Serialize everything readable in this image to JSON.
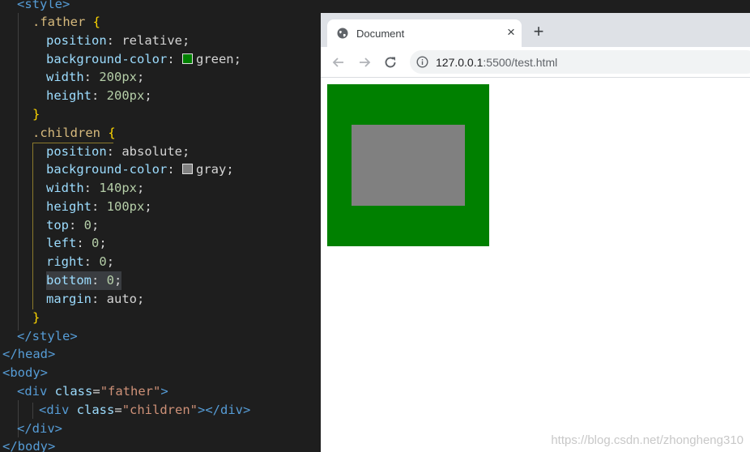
{
  "editor": {
    "lines": {
      "l0": {
        "tag": "<style>"
      },
      "l1": {
        "selector": ".father",
        "brace": "{"
      },
      "l2": {
        "prop": "position",
        "value": "relative"
      },
      "l3": {
        "prop": "background-color",
        "value": "green",
        "swatch": "#008000"
      },
      "l4": {
        "prop": "width",
        "value": "200px"
      },
      "l5": {
        "prop": "height",
        "value": "200px"
      },
      "l6": {
        "brace": "}"
      },
      "l7": {
        "selector": ".children",
        "brace": "{"
      },
      "l8": {
        "prop": "position",
        "value": "absolute"
      },
      "l9": {
        "prop": "background-color",
        "value": "gray",
        "swatch": "#808080"
      },
      "l10": {
        "prop": "width",
        "value": "140px"
      },
      "l11": {
        "prop": "height",
        "value": "100px"
      },
      "l12": {
        "prop": "top",
        "value": "0"
      },
      "l13": {
        "prop": "left",
        "value": "0"
      },
      "l14": {
        "prop": "right",
        "value": "0"
      },
      "l15": {
        "prop": "bottom",
        "value": "0"
      },
      "l16": {
        "prop": "margin",
        "value": "auto"
      },
      "l17": {
        "brace": "}"
      },
      "l18": {
        "tag": "</style>"
      },
      "l19": {
        "tag": "</head>"
      },
      "l20": {
        "tag": "<body>"
      },
      "l21": {
        "open": "<div",
        "attr": "class",
        "eq": "=",
        "str": "\"father\"",
        "close": ">"
      },
      "l22": {
        "open": "<div",
        "attr": "class",
        "eq": "=",
        "str": "\"children\"",
        "close": "></div>"
      },
      "l23": {
        "tag": "</div>"
      },
      "l24": {
        "tag": "</body>"
      }
    }
  },
  "browser": {
    "tab_title": "Document",
    "tab_close": "×",
    "new_tab": "+",
    "url_host": "127.0.0.1",
    "url_rest": ":5500/test.html"
  },
  "watermark": "https://blog.csdn.net/zhongheng310",
  "colors": {
    "father": "#008000",
    "children": "#808080"
  }
}
